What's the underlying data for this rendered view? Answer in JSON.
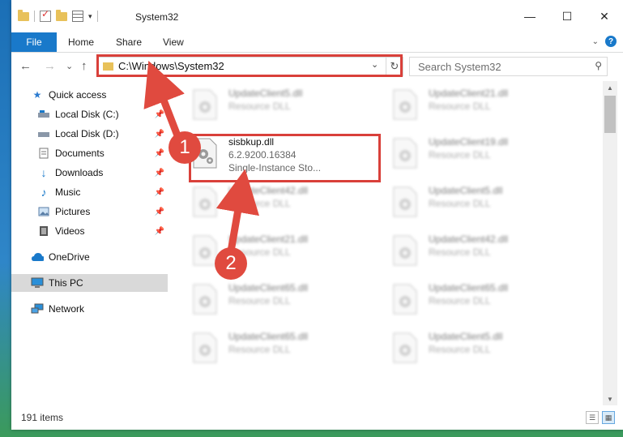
{
  "window": {
    "title": "System32",
    "controls": {
      "minimize": "—",
      "maximize": "☐",
      "close": "✕"
    }
  },
  "ribbon": {
    "tabs": [
      "File",
      "Home",
      "Share",
      "View"
    ],
    "expand_icon": "chevron-down-icon",
    "help_label": "?"
  },
  "nav": {
    "back": "←",
    "forward": "→",
    "recent": "⌄",
    "up": "↑",
    "address": "C:\\Windows\\System32",
    "address_dropdown": "⌄",
    "refresh": "↻",
    "search_placeholder": "Search System32"
  },
  "sidebar": {
    "items": [
      {
        "label": "Quick access",
        "icon": "star-icon",
        "pinned": false
      },
      {
        "label": "Local Disk (C:)",
        "icon": "drive-icon",
        "pinned": true
      },
      {
        "label": "Local Disk (D:)",
        "icon": "drive-icon",
        "pinned": true
      },
      {
        "label": "Documents",
        "icon": "document-icon",
        "pinned": true
      },
      {
        "label": "Downloads",
        "icon": "download-icon",
        "pinned": true
      },
      {
        "label": "Music",
        "icon": "music-icon",
        "pinned": true
      },
      {
        "label": "Pictures",
        "icon": "picture-icon",
        "pinned": true
      },
      {
        "label": "Videos",
        "icon": "video-icon",
        "pinned": true
      },
      {
        "label": "OneDrive",
        "icon": "cloud-icon",
        "pinned": false
      },
      {
        "label": "This PC",
        "icon": "computer-icon",
        "pinned": false,
        "selected": true
      },
      {
        "label": "Network",
        "icon": "network-icon",
        "pinned": false
      }
    ]
  },
  "files": {
    "left": [
      {
        "name": "UpdateClient5.dll",
        "l2": "Resource DLL",
        "l3": ""
      },
      {
        "name": "sisbkup.dll",
        "l2": "6.2.9200.16384",
        "l3": "Single-Instance Sto...",
        "highlighted": true
      },
      {
        "name": "UpdateClient42.dll",
        "l2": "Resource DLL",
        "l3": ""
      },
      {
        "name": "UpdateClient21.dll",
        "l2": "Resource DLL",
        "l3": ""
      },
      {
        "name": "UpdateClient65.dll",
        "l2": "Resource DLL",
        "l3": ""
      },
      {
        "name": "UpdateClient65.dll",
        "l2": "Resource DLL",
        "l3": ""
      }
    ],
    "right": [
      {
        "name": "UpdateClient21.dll",
        "l2": "Resource DLL"
      },
      {
        "name": "UpdateClient19.dll",
        "l2": "Resource DLL"
      },
      {
        "name": "UpdateClient5.dll",
        "l2": "Resource DLL"
      },
      {
        "name": "UpdateClient42.dll",
        "l2": "Resource DLL"
      },
      {
        "name": "UpdateClient65.dll",
        "l2": "Resource DLL"
      },
      {
        "name": "UpdateClient5.dll",
        "l2": "Resource DLL"
      }
    ]
  },
  "status": {
    "item_count": "191 items"
  },
  "annotations": {
    "step1": "1",
    "step2": "2",
    "color": "#e04a3f"
  }
}
